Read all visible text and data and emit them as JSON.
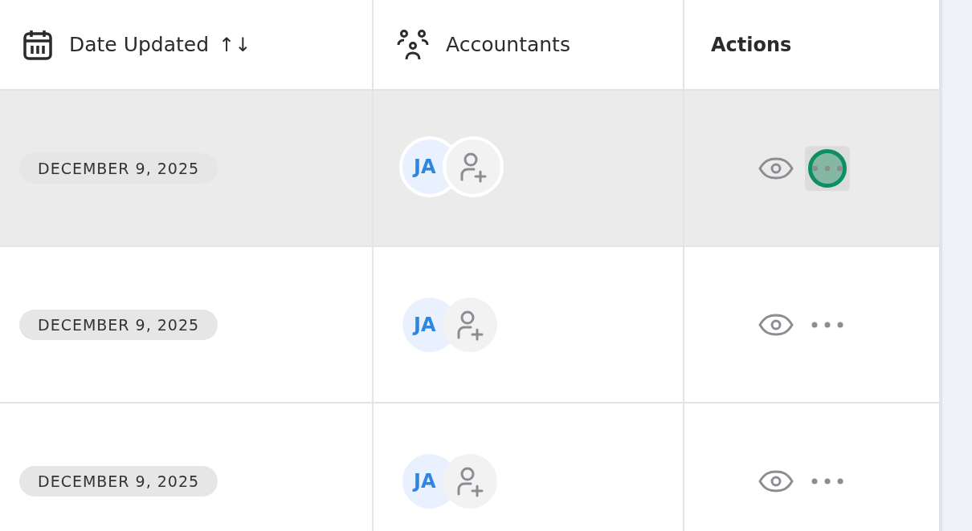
{
  "table": {
    "columns": [
      {
        "label": "Date Updated",
        "kind": "date",
        "sort": "↑↓"
      },
      {
        "label": "Accountants",
        "kind": "people"
      },
      {
        "label": "Actions",
        "kind": "plain"
      }
    ],
    "rows": [
      {
        "date": "DECEMBER 9, 2025",
        "initials": "JA",
        "selected": true,
        "menu_focused": true
      },
      {
        "date": "DECEMBER 9, 2025",
        "initials": "JA",
        "selected": false,
        "menu_focused": false
      },
      {
        "date": "DECEMBER 9, 2025",
        "initials": "JA",
        "selected": false,
        "menu_focused": false
      }
    ]
  }
}
